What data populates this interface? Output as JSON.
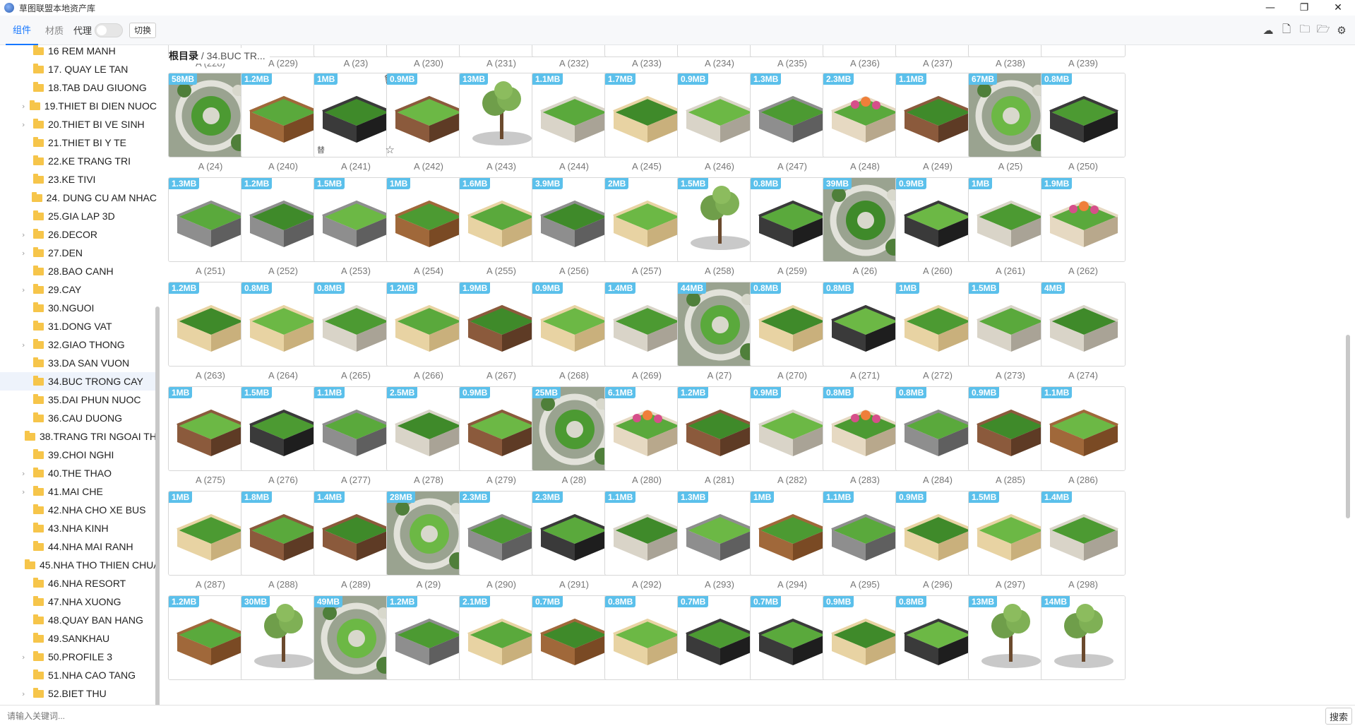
{
  "app": {
    "title": "草图联盟本地资产库"
  },
  "window_controls": {
    "minimize": "—",
    "maximize": "❐",
    "close": "✕"
  },
  "toolbar": {
    "tabs": [
      {
        "label": "组件",
        "active": true
      },
      {
        "label": "材质",
        "active": false
      }
    ],
    "proxy_label": "代理",
    "switch_label": "切换",
    "icons": [
      "cloud-icon",
      "new-file-icon",
      "add-folder-icon",
      "folder-icon",
      "settings-icon"
    ]
  },
  "sidebar": {
    "items": [
      {
        "label": "16 REM MANH",
        "expandable": false
      },
      {
        "label": "17. QUAY LE TAN",
        "expandable": false
      },
      {
        "label": "18.TAB DAU GIUONG",
        "expandable": false
      },
      {
        "label": "19.THIET BI DIEN NUOC",
        "expandable": true
      },
      {
        "label": "20.THIET BI VE SINH",
        "expandable": true
      },
      {
        "label": "21.THIET BI Y TE",
        "expandable": false
      },
      {
        "label": "22.KE TRANG TRI",
        "expandable": false
      },
      {
        "label": "23.KE TIVI",
        "expandable": false
      },
      {
        "label": "24. DUNG CU AM NHAC",
        "expandable": false
      },
      {
        "label": "25.GIA LAP 3D",
        "expandable": false
      },
      {
        "label": "26.DECOR",
        "expandable": true
      },
      {
        "label": "27.DEN",
        "expandable": true
      },
      {
        "label": "28.BAO CANH",
        "expandable": false
      },
      {
        "label": "29.CAY",
        "expandable": true
      },
      {
        "label": "30.NGUOI",
        "expandable": false
      },
      {
        "label": "31.DONG VAT",
        "expandable": false
      },
      {
        "label": "32.GIAO THONG",
        "expandable": true
      },
      {
        "label": "33.DA SAN VUON",
        "expandable": false
      },
      {
        "label": "34.BUC TRONG CAY",
        "expandable": false,
        "selected": true
      },
      {
        "label": "35.DAI PHUN NUOC",
        "expandable": false
      },
      {
        "label": "36.CAU DUONG",
        "expandable": false
      },
      {
        "label": "38.TRANG TRI NGOAI THAT",
        "expandable": false
      },
      {
        "label": "39.CHOI NGHI",
        "expandable": false
      },
      {
        "label": "40.THE THAO",
        "expandable": true
      },
      {
        "label": "41.MAI CHE",
        "expandable": true
      },
      {
        "label": "42.NHA CHO XE BUS",
        "expandable": false
      },
      {
        "label": "43.NHA KINH",
        "expandable": false
      },
      {
        "label": "44.NHA MAI RANH",
        "expandable": false
      },
      {
        "label": "45.NHA THO THIEN CHUA",
        "expandable": false
      },
      {
        "label": "46.NHA RESORT",
        "expandable": false
      },
      {
        "label": "47.NHA XUONG",
        "expandable": false
      },
      {
        "label": "48.QUAY BAN HANG",
        "expandable": false
      },
      {
        "label": "49.SANKHAU",
        "expandable": false
      },
      {
        "label": "50.PROFILE 3",
        "expandable": true
      },
      {
        "label": "51.NHA CAO TANG",
        "expandable": false
      },
      {
        "label": "52.BIET THU",
        "expandable": true
      }
    ]
  },
  "breadcrumb": {
    "root": "根目录",
    "separator": " / ",
    "current": "34.BUC TR..."
  },
  "hover_actions": {
    "delete": "🗑",
    "replace": "替",
    "favorite": "☆"
  },
  "grid": {
    "top_labels": [
      "A (228)",
      "A (229)",
      "A (23)",
      "A (230)",
      "A (231)",
      "A (232)",
      "A (233)",
      "A (234)",
      "A (235)",
      "A (236)",
      "A (237)",
      "A (238)",
      "A (239)"
    ],
    "rows": [
      [
        {
          "size": "58MB",
          "label": "A (24)",
          "kind": "plan"
        },
        {
          "size": "1.2MB",
          "label": "A (240)",
          "kind": "wood"
        },
        {
          "size": "1MB",
          "label": "A (241)",
          "kind": "dark",
          "hover": true
        },
        {
          "size": "0.9MB",
          "label": "A (242)",
          "kind": "brown"
        },
        {
          "size": "13MB",
          "label": "A (243)",
          "kind": "tree"
        },
        {
          "size": "1.1MB",
          "label": "A (244)",
          "kind": "stone"
        },
        {
          "size": "1.7MB",
          "label": "A (245)",
          "kind": "sand"
        },
        {
          "size": "0.9MB",
          "label": "A (246)",
          "kind": "stone"
        },
        {
          "size": "1.3MB",
          "label": "A (247)",
          "kind": "grey"
        },
        {
          "size": "2.3MB",
          "label": "A (248)",
          "kind": "flower"
        },
        {
          "size": "1.1MB",
          "label": "A (249)",
          "kind": "brown"
        },
        {
          "size": "67MB",
          "label": "A (25)",
          "kind": "plan"
        },
        {
          "size": "0.8MB",
          "label": "A (250)",
          "kind": "dark"
        }
      ],
      [
        {
          "size": "1.3MB",
          "label": "A (251)",
          "kind": "grey"
        },
        {
          "size": "1.2MB",
          "label": "A (252)",
          "kind": "grey"
        },
        {
          "size": "1.5MB",
          "label": "A (253)",
          "kind": "grey"
        },
        {
          "size": "1MB",
          "label": "A (254)",
          "kind": "wood"
        },
        {
          "size": "1.6MB",
          "label": "A (255)",
          "kind": "sand"
        },
        {
          "size": "3.9MB",
          "label": "A (256)",
          "kind": "grey"
        },
        {
          "size": "2MB",
          "label": "A (257)",
          "kind": "sand"
        },
        {
          "size": "1.5MB",
          "label": "A (258)",
          "kind": "tree"
        },
        {
          "size": "0.8MB",
          "label": "A (259)",
          "kind": "dark"
        },
        {
          "size": "39MB",
          "label": "A (26)",
          "kind": "plan"
        },
        {
          "size": "0.9MB",
          "label": "A (260)",
          "kind": "dark"
        },
        {
          "size": "1MB",
          "label": "A (261)",
          "kind": "stone"
        },
        {
          "size": "1.9MB",
          "label": "A (262)",
          "kind": "flower"
        }
      ],
      [
        {
          "size": "1.2MB",
          "label": "A (263)",
          "kind": "sand"
        },
        {
          "size": "0.8MB",
          "label": "A (264)",
          "kind": "sand"
        },
        {
          "size": "0.8MB",
          "label": "A (265)",
          "kind": "stone"
        },
        {
          "size": "1.2MB",
          "label": "A (266)",
          "kind": "sand"
        },
        {
          "size": "1.9MB",
          "label": "A (267)",
          "kind": "brown"
        },
        {
          "size": "0.9MB",
          "label": "A (268)",
          "kind": "sand"
        },
        {
          "size": "1.4MB",
          "label": "A (269)",
          "kind": "stone"
        },
        {
          "size": "44MB",
          "label": "A (27)",
          "kind": "plan"
        },
        {
          "size": "0.8MB",
          "label": "A (270)",
          "kind": "sand"
        },
        {
          "size": "0.8MB",
          "label": "A (271)",
          "kind": "dark"
        },
        {
          "size": "1MB",
          "label": "A (272)",
          "kind": "sand"
        },
        {
          "size": "1.5MB",
          "label": "A (273)",
          "kind": "stone"
        },
        {
          "size": "4MB",
          "label": "A (274)",
          "kind": "stone"
        }
      ],
      [
        {
          "size": "1MB",
          "label": "A (275)",
          "kind": "brown"
        },
        {
          "size": "1.5MB",
          "label": "A (276)",
          "kind": "dark"
        },
        {
          "size": "1.1MB",
          "label": "A (277)",
          "kind": "grey"
        },
        {
          "size": "2.5MB",
          "label": "A (278)",
          "kind": "stone"
        },
        {
          "size": "0.9MB",
          "label": "A (279)",
          "kind": "brown"
        },
        {
          "size": "25MB",
          "label": "A (28)",
          "kind": "plan"
        },
        {
          "size": "6.1MB",
          "label": "A (280)",
          "kind": "flower"
        },
        {
          "size": "1.2MB",
          "label": "A (281)",
          "kind": "brown"
        },
        {
          "size": "0.9MB",
          "label": "A (282)",
          "kind": "stone"
        },
        {
          "size": "0.8MB",
          "label": "A (283)",
          "kind": "flower"
        },
        {
          "size": "0.8MB",
          "label": "A (284)",
          "kind": "grey"
        },
        {
          "size": "0.9MB",
          "label": "A (285)",
          "kind": "brown"
        },
        {
          "size": "1.1MB",
          "label": "A (286)",
          "kind": "wood"
        }
      ],
      [
        {
          "size": "1MB",
          "label": "A (287)",
          "kind": "sand"
        },
        {
          "size": "1.8MB",
          "label": "A (288)",
          "kind": "brown"
        },
        {
          "size": "1.4MB",
          "label": "A (289)",
          "kind": "brown"
        },
        {
          "size": "28MB",
          "label": "A (29)",
          "kind": "plan"
        },
        {
          "size": "2.3MB",
          "label": "A (290)",
          "kind": "grey"
        },
        {
          "size": "2.3MB",
          "label": "A (291)",
          "kind": "dark"
        },
        {
          "size": "1.1MB",
          "label": "A (292)",
          "kind": "stone"
        },
        {
          "size": "1.3MB",
          "label": "A (293)",
          "kind": "grey"
        },
        {
          "size": "1MB",
          "label": "A (294)",
          "kind": "wood"
        },
        {
          "size": "1.1MB",
          "label": "A (295)",
          "kind": "grey"
        },
        {
          "size": "0.9MB",
          "label": "A (296)",
          "kind": "sand"
        },
        {
          "size": "1.5MB",
          "label": "A (297)",
          "kind": "sand"
        },
        {
          "size": "1.4MB",
          "label": "A (298)",
          "kind": "stone"
        }
      ],
      [
        {
          "size": "1.2MB",
          "label": "",
          "kind": "wood"
        },
        {
          "size": "30MB",
          "label": "",
          "kind": "tree"
        },
        {
          "size": "49MB",
          "label": "",
          "kind": "plan"
        },
        {
          "size": "1.2MB",
          "label": "",
          "kind": "grey"
        },
        {
          "size": "2.1MB",
          "label": "",
          "kind": "sand"
        },
        {
          "size": "0.7MB",
          "label": "",
          "kind": "wood"
        },
        {
          "size": "0.8MB",
          "label": "",
          "kind": "sand"
        },
        {
          "size": "0.7MB",
          "label": "",
          "kind": "dark"
        },
        {
          "size": "0.7MB",
          "label": "",
          "kind": "dark"
        },
        {
          "size": "0.9MB",
          "label": "",
          "kind": "sand"
        },
        {
          "size": "0.8MB",
          "label": "",
          "kind": "dark"
        },
        {
          "size": "13MB",
          "label": "",
          "kind": "tree"
        },
        {
          "size": "14MB",
          "label": "",
          "kind": "tree"
        }
      ]
    ]
  },
  "search": {
    "placeholder": "请输入关键词...",
    "button_label": "搜索"
  },
  "colors": {
    "accent": "#1677ff",
    "badge": "#5bc0eb",
    "grass": "#4c9a32",
    "folder": "#f6c54a"
  }
}
